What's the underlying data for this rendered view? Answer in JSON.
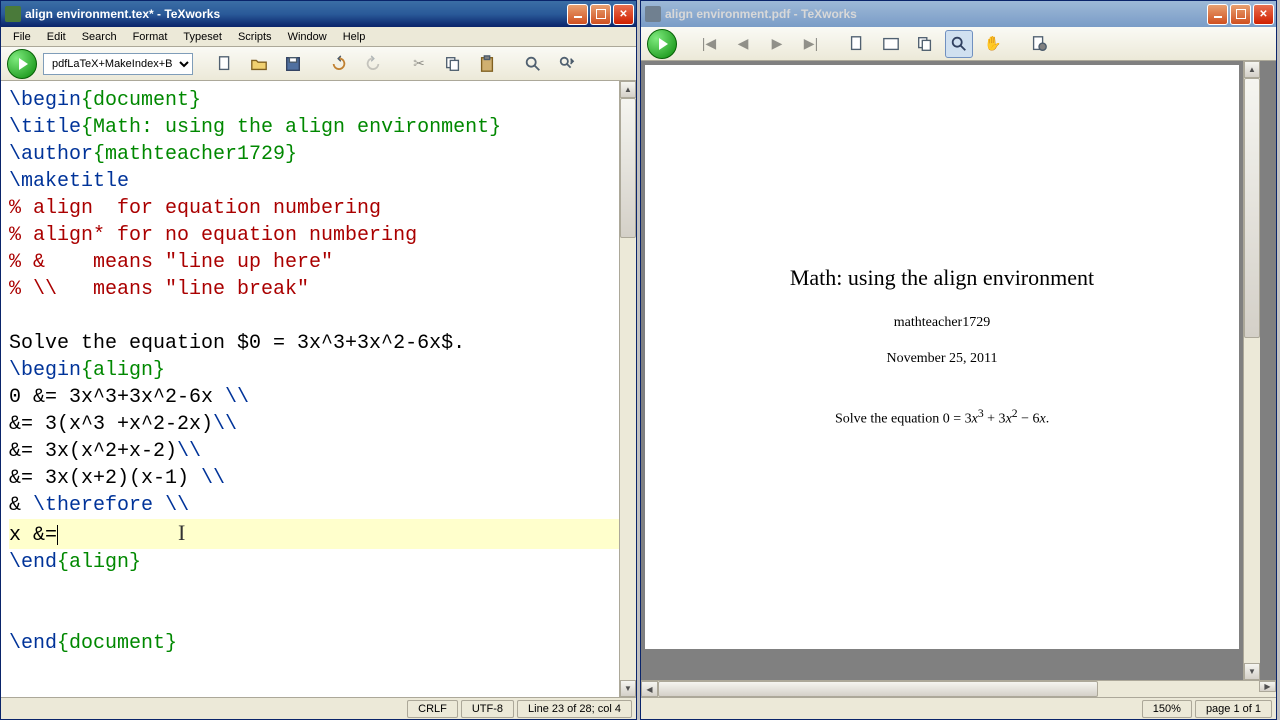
{
  "app_name": "TeXworks",
  "editor_window": {
    "title": "align environment.tex* - TeXworks",
    "menus": [
      "File",
      "Edit",
      "Search",
      "Format",
      "Typeset",
      "Scripts",
      "Window",
      "Help"
    ],
    "engine_selected": "pdfLaTeX+MakeIndex+BibTeX",
    "status": {
      "line_ending": "CRLF",
      "encoding": "UTF-8",
      "position": "Line 23 of 28; col 4"
    },
    "code_lines": [
      {
        "segments": [
          {
            "t": "\\begin",
            "c": "cmd"
          },
          {
            "t": "{document}",
            "c": "arg"
          }
        ]
      },
      {
        "segments": [
          {
            "t": "\\title",
            "c": "cmd"
          },
          {
            "t": "{Math: using the align environment}",
            "c": "arg"
          }
        ]
      },
      {
        "segments": [
          {
            "t": "\\author",
            "c": "cmd"
          },
          {
            "t": "{mathteacher1729}",
            "c": "arg"
          }
        ]
      },
      {
        "segments": [
          {
            "t": "\\maketitle",
            "c": "cmd"
          }
        ]
      },
      {
        "segments": [
          {
            "t": "% align  for equation numbering",
            "c": "comment"
          }
        ]
      },
      {
        "segments": [
          {
            "t": "% align* for no equation numbering",
            "c": "comment"
          }
        ]
      },
      {
        "segments": [
          {
            "t": "% &    means \"line up here\"",
            "c": "comment"
          }
        ]
      },
      {
        "segments": [
          {
            "t": "% \\\\   means \"line break\"",
            "c": "comment"
          }
        ]
      },
      {
        "segments": [
          {
            "t": "",
            "c": ""
          }
        ]
      },
      {
        "segments": [
          {
            "t": "Solve the equation $0 = 3x^3+3x^2-6x$.",
            "c": ""
          }
        ]
      },
      {
        "segments": [
          {
            "t": "\\begin",
            "c": "cmd"
          },
          {
            "t": "{align}",
            "c": "arg"
          }
        ]
      },
      {
        "segments": [
          {
            "t": "0 &= 3x^3+3x^2-6x ",
            "c": ""
          },
          {
            "t": "\\\\",
            "c": "cmd"
          }
        ]
      },
      {
        "segments": [
          {
            "t": "&= 3(x^3 +x^2-2x)",
            "c": ""
          },
          {
            "t": "\\\\",
            "c": "cmd"
          }
        ]
      },
      {
        "segments": [
          {
            "t": "&= 3x(x^2+x-2)",
            "c": ""
          },
          {
            "t": "\\\\",
            "c": "cmd"
          }
        ]
      },
      {
        "segments": [
          {
            "t": "&= 3x(x+2)(x-1) ",
            "c": ""
          },
          {
            "t": "\\\\",
            "c": "cmd"
          }
        ]
      },
      {
        "segments": [
          {
            "t": "& ",
            "c": ""
          },
          {
            "t": "\\therefore",
            "c": "cmd"
          },
          {
            "t": " ",
            "c": ""
          },
          {
            "t": "\\\\",
            "c": "cmd"
          }
        ]
      },
      {
        "segments": [
          {
            "t": "x &=",
            "c": ""
          }
        ],
        "highlight": true,
        "cursor_after": true,
        "ibeam": true
      },
      {
        "segments": [
          {
            "t": "\\end",
            "c": "cmd"
          },
          {
            "t": "{align}",
            "c": "arg"
          }
        ]
      },
      {
        "segments": [
          {
            "t": "",
            "c": ""
          }
        ]
      },
      {
        "segments": [
          {
            "t": "",
            "c": ""
          }
        ]
      },
      {
        "segments": [
          {
            "t": "\\end",
            "c": "cmd"
          },
          {
            "t": "{document}",
            "c": "arg"
          }
        ]
      }
    ]
  },
  "pdf_window": {
    "title": "align environment.pdf - TeXworks",
    "rendered": {
      "title": "Math: using the align environment",
      "author": "mathteacher1729",
      "date": "November 25, 2011",
      "body_html": "Solve the equation 0 = 3<i>x</i><sup>3</sup> + 3<i>x</i><sup>2</sup> − 6<i>x</i>."
    },
    "status": {
      "zoom": "150%",
      "page": "page 1 of 1"
    }
  }
}
